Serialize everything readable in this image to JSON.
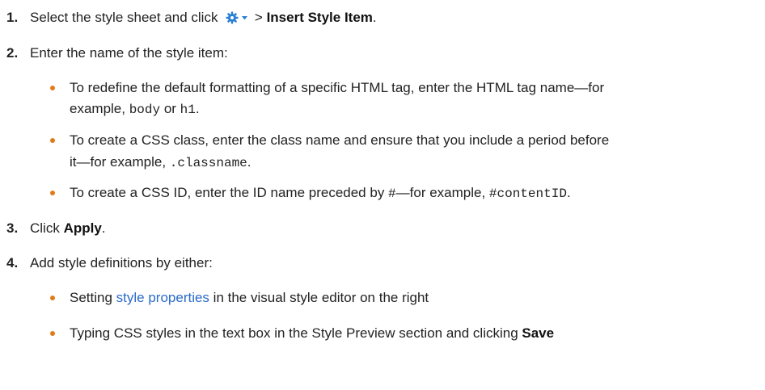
{
  "colors": {
    "bullet": "#e07b1a",
    "link": "#2a6bc9",
    "gear": "#2a7fd1"
  },
  "steps": [
    {
      "num": "1.",
      "pre": "Select the style sheet and click",
      "icon": "gear-dropdown-icon",
      "mid": " > ",
      "bold": "Insert Style Item",
      "post": "."
    },
    {
      "num": "2.",
      "text": "Enter the name of the style item:"
    },
    {
      "num": "3.",
      "pre": "Click ",
      "bold": "Apply",
      "post": "."
    },
    {
      "num": "4.",
      "text": "Add style definitions by either:"
    }
  ],
  "step2_bullets": [
    {
      "line1": "To redefine the default formatting of a specific HTML tag, enter the HTML tag name—for",
      "l2_pre": "example, ",
      "code1": "body",
      "l2_mid": " or ",
      "code2": "h1",
      "l2_post": "."
    },
    {
      "line1": "To create a CSS class, enter the class name and ensure that you include a period before",
      "l2_pre": "it—for example, ",
      "code1": ".classname",
      "l2_post": "."
    },
    {
      "pre": "To create a CSS ID, enter the ID name preceded by ",
      "code1": "#",
      "mid": "—for example, ",
      "code2": "#contentID",
      "post": "."
    }
  ],
  "step4_bullets": [
    {
      "pre": "Setting ",
      "link": "style properties",
      "post": " in the visual style editor on the right"
    },
    {
      "pre": "Typing CSS styles in the text box in the Style Preview section and clicking ",
      "bold": "Save"
    }
  ]
}
